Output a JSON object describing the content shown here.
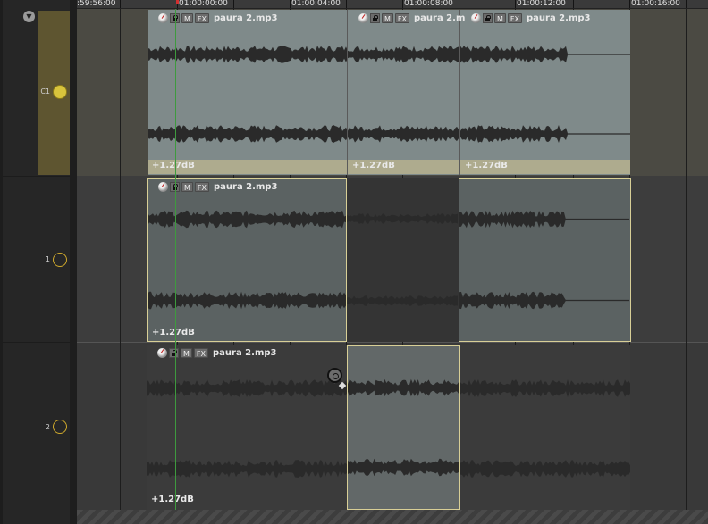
{
  "ruler": {
    "labels": [
      ":59:56:00",
      "01:00:00:00",
      "01:00:04:00",
      "01:00:08:00",
      "01:00:12:00",
      "01:00:16:00"
    ]
  },
  "tracks": [
    {
      "name": "C1",
      "color": "#5e5530",
      "led": "#d8c43c",
      "led_filled": true
    },
    {
      "name": "1",
      "color": "#262626",
      "led": "#cfa92c",
      "led_filled": false
    },
    {
      "name": "2",
      "color": "#262626",
      "led": "#cfa92c",
      "led_filled": false
    }
  ],
  "item_header": {
    "mute": "M",
    "fx": "FX",
    "file": "paura 2.mp3",
    "file_cut": "paura 2.m"
  },
  "volume_label": "+1.27dB",
  "icons": {
    "collapse": "triangle-down-icon",
    "knob": "item-volume-knob-icon",
    "lock": "lock-icon",
    "cursor": "trim-cursor-icon"
  }
}
